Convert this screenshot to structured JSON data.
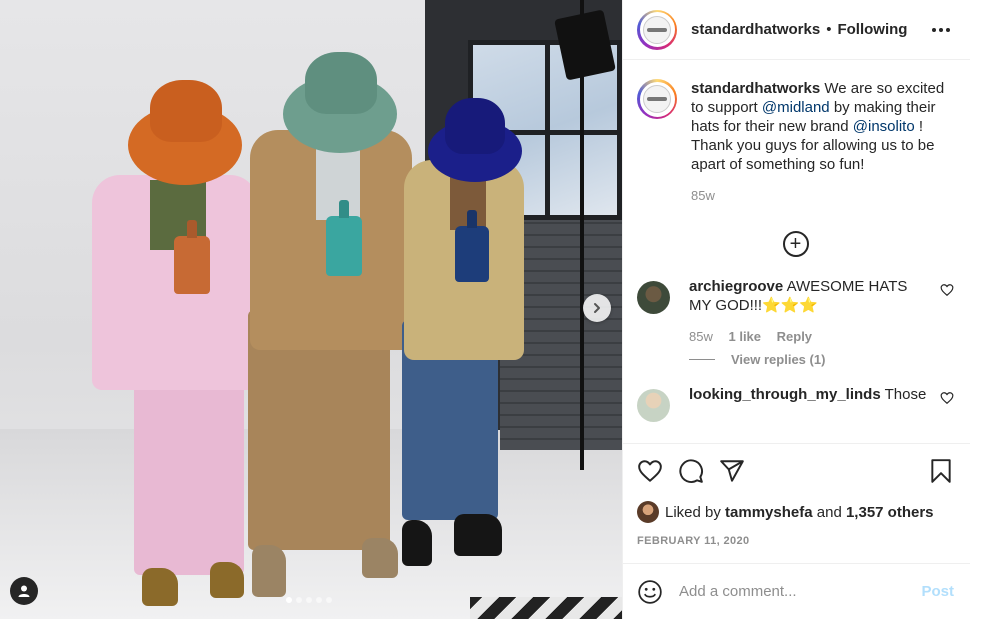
{
  "post": {
    "username": "standardhatworks",
    "follow_status": "Following",
    "separator": "•"
  },
  "caption": {
    "username": "standardhatworks",
    "text_1": "We are so excited to support",
    "mention_1": "@midland",
    "text_2": "by making their hats for their new brand",
    "mention_2": "@insolito",
    "text_3": "! Thank you guys for allowing us to be apart of something so fun!",
    "age": "85w"
  },
  "comments": [
    {
      "username": "archiegroove",
      "text": "AWESOME HATS MY GOD!!!⭐⭐⭐",
      "age": "85w",
      "likes": "1 like",
      "reply_label": "Reply",
      "view_replies": "View replies (1)"
    },
    {
      "username": "looking_through_my_linds",
      "text": "Those"
    }
  ],
  "likes": {
    "prefix": "Liked by",
    "user": "tammyshefa",
    "joiner": "and",
    "others": "1,357 others"
  },
  "date": "FEBRUARY 11, 2020",
  "add_comment": {
    "placeholder": "Add a comment...",
    "post_label": "Post"
  },
  "carousel": {
    "total": 5,
    "active_index": 0
  },
  "colors": {
    "mention": "#00376b",
    "post_disabled": "#b2dffc",
    "muted": "#8e8e8e"
  },
  "icons": [
    "more-options-icon",
    "load-more-icon",
    "heart-icon",
    "comment-icon",
    "share-icon",
    "bookmark-icon",
    "emoji-icon",
    "next-arrow-icon",
    "tagged-user-icon"
  ]
}
